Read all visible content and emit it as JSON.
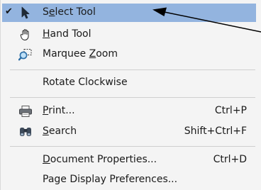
{
  "menu": {
    "items": [
      {
        "label": "Select Tool",
        "mnemonic_index": 1,
        "icon": "pointer-icon",
        "checked": true,
        "shortcut": ""
      },
      {
        "label": "Hand Tool",
        "mnemonic_index": 0,
        "icon": "hand-icon",
        "checked": false,
        "shortcut": ""
      },
      {
        "label": "Marquee Zoom",
        "mnemonic_index": 8,
        "icon": "marquee-zoom-icon",
        "checked": false,
        "shortcut": ""
      },
      {
        "label": "Rotate Clockwise",
        "mnemonic_index": -1,
        "icon": "",
        "checked": false,
        "shortcut": ""
      },
      {
        "label": "Print...",
        "mnemonic_index": 0,
        "icon": "printer-icon",
        "checked": false,
        "shortcut": "Ctrl+P"
      },
      {
        "label": "Search",
        "mnemonic_index": 0,
        "icon": "binoculars-icon",
        "checked": false,
        "shortcut": "Shift+Ctrl+F"
      },
      {
        "label": "Document Properties...",
        "mnemonic_index": 0,
        "icon": "",
        "checked": false,
        "shortcut": "Ctrl+D"
      },
      {
        "label": "Page Display Preferences...",
        "mnemonic_index": -1,
        "icon": "",
        "checked": false,
        "shortcut": ""
      }
    ],
    "check_glyph": "✔",
    "colors": {
      "selected_bg": "#93b4df",
      "menu_bg": "#f4f4f4",
      "separator": "#cfcfcf"
    }
  }
}
